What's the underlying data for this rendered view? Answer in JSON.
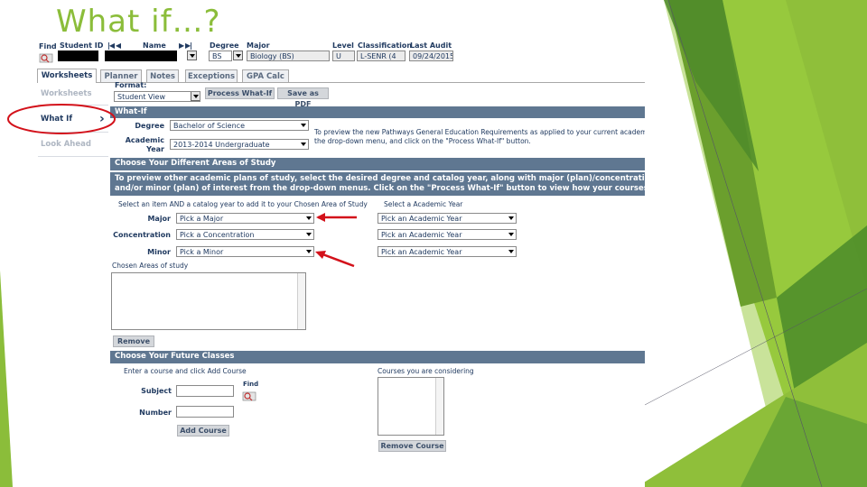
{
  "slide": {
    "title": "What if…?"
  },
  "header": {
    "find_label": "Find",
    "student_id_label": "Student ID",
    "name_label": "Name",
    "degree_label": "Degree",
    "degree_value": "BS",
    "major_label": "Major",
    "major_value": "Biology (BS)",
    "level_label": "Level",
    "level_value": "U",
    "classification_label": "Classification",
    "classification_value": "L-SENR (4",
    "last_audit_label": "Last Audit",
    "last_audit_value": "09/24/2015"
  },
  "tabs": [
    "Worksheets",
    "Planner",
    "Notes",
    "Exceptions",
    "GPA Calc"
  ],
  "format": {
    "label": "Format:",
    "value": "Student View",
    "process_button": "Process What-If",
    "pdf_button": "Save as PDF"
  },
  "sidebar": {
    "items": [
      "Worksheets",
      "What If",
      "Look Ahead"
    ]
  },
  "whatif": {
    "bar": "What-If",
    "degree_label": "Degree",
    "degree_value": "Bachelor of Science",
    "year_label_1": "Academic",
    "year_label_2": "Year",
    "year_value": "2013-2014 Undergraduate",
    "info_1": "To preview the new Pathways General Education Requirements as applied to your current academic plan require",
    "info_2": "the drop-down menu, and click on the \"Process What-If\" button."
  },
  "areas": {
    "bar": "Choose Your Different Areas of Study",
    "instructions_1": "To preview other academic plans of study, select the desired degree and catalog year, along with major (plan)/concentration (sub-plan)",
    "instructions_2": "and/or minor (plan) of interest from the drop-down menus. Click on the \"Process What-If\" button to view how your courses get applied.",
    "select_item_note": "Select an item AND a catalog year to add it to your Chosen Area of Study",
    "select_year_note": "Select a Academic Year",
    "rows": [
      {
        "label": "Major",
        "value": "Pick a Major",
        "year": "Pick an Academic Year"
      },
      {
        "label": "Concentration",
        "value": "Pick a Concentration",
        "year": "Pick an Academic Year"
      },
      {
        "label": "Minor",
        "value": "Pick a Minor",
        "year": "Pick an Academic Year"
      }
    ],
    "chosen_label": "Chosen Areas of study",
    "remove_button": "Remove"
  },
  "future": {
    "bar": "Choose Your Future Classes",
    "enter_note": "Enter a course and click Add Course",
    "considering_label": "Courses you are considering",
    "subject_label": "Subject",
    "number_label": "Number",
    "find_label": "Find",
    "add_button": "Add Course",
    "remove_button": "Remove Course"
  },
  "colors": {
    "accent_green": "#8bbd3a",
    "bar_blue": "#5f7791",
    "annotation_red": "#d3111a"
  }
}
